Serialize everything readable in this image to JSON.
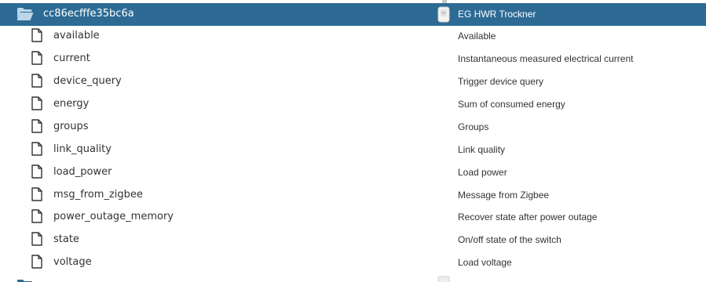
{
  "folder": {
    "name": "cc86ecfffe35bc6a",
    "device_name": "EG HWR Trockner",
    "icon": "folder-open-icon",
    "device_icon": "smart-plug-icon"
  },
  "files": [
    {
      "name": "available",
      "description": "Available"
    },
    {
      "name": "current",
      "description": "Instantaneous measured electrical current"
    },
    {
      "name": "device_query",
      "description": "Trigger device query"
    },
    {
      "name": "energy",
      "description": "Sum of consumed energy"
    },
    {
      "name": "groups",
      "description": "Groups"
    },
    {
      "name": "link_quality",
      "description": "Link quality"
    },
    {
      "name": "load_power",
      "description": "Load power"
    },
    {
      "name": "msg_from_zigbee",
      "description": "Message from Zigbee"
    },
    {
      "name": "power_outage_memory",
      "description": "Recover state after power outage"
    },
    {
      "name": "state",
      "description": "On/off state of the switch"
    },
    {
      "name": "voltage",
      "description": "Load voltage"
    }
  ],
  "colors": {
    "selected_row_bg": "#2d6b95",
    "selected_row_text": "#ffffff",
    "text": "#333333"
  }
}
